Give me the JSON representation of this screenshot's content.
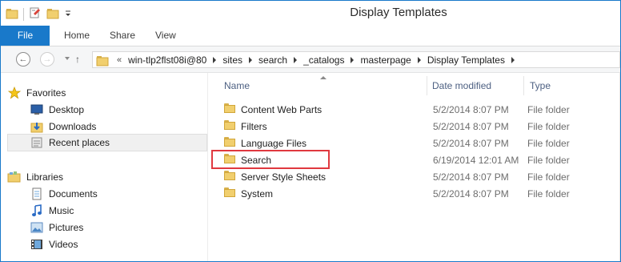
{
  "window": {
    "title": "Display Templates"
  },
  "ribbon": {
    "tabs": [
      "File",
      "Home",
      "Share",
      "View"
    ]
  },
  "address": {
    "prefix": "«",
    "crumbs": [
      "win-tlp2flst08i@80",
      "sites",
      "search",
      "_catalogs",
      "masterpage",
      "Display Templates"
    ]
  },
  "nav": {
    "favorites_label": "Favorites",
    "favorites": [
      "Desktop",
      "Downloads",
      "Recent places"
    ],
    "libraries_label": "Libraries",
    "libraries": [
      "Documents",
      "Music",
      "Pictures",
      "Videos"
    ]
  },
  "columns": {
    "name": "Name",
    "date": "Date modified",
    "type": "Type"
  },
  "files": [
    {
      "name": "Content Web Parts",
      "date": "5/2/2014 8:07 PM",
      "type": "File folder"
    },
    {
      "name": "Filters",
      "date": "5/2/2014 8:07 PM",
      "type": "File folder"
    },
    {
      "name": "Language Files",
      "date": "5/2/2014 8:07 PM",
      "type": "File folder"
    },
    {
      "name": "Search",
      "date": "6/19/2014 12:01 AM",
      "type": "File folder"
    },
    {
      "name": "Server Style Sheets",
      "date": "5/2/2014 8:07 PM",
      "type": "File folder"
    },
    {
      "name": "System",
      "date": "5/2/2014 8:07 PM",
      "type": "File folder"
    }
  ],
  "colors": {
    "accent": "#1979ca",
    "highlight_box": "#e0393f",
    "folder": "#f1cf6e"
  }
}
